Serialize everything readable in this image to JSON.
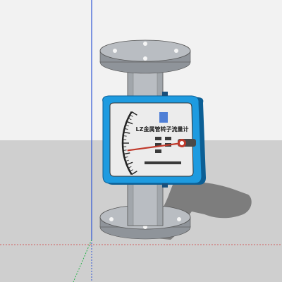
{
  "scene": {
    "colors": {
      "sky": "#f2f2f2",
      "ground": "#cfcfcf",
      "steel": "#b9bdc2",
      "steel_dark": "#8f949a",
      "housing_blue": "#1e9be0",
      "housing_blue_dark": "#0c5f95",
      "dial_face": "#ececec",
      "pointer_red": "#c0392b",
      "axis_blue": "#2f55d4",
      "axis_green": "#27b24a",
      "axis_red": "#d33b3b",
      "shadow": "#6f6f6f"
    }
  },
  "meter": {
    "label": "LZ金属管转子流量计",
    "scale_tick_count": 18,
    "pointer_level": 0.62
  }
}
